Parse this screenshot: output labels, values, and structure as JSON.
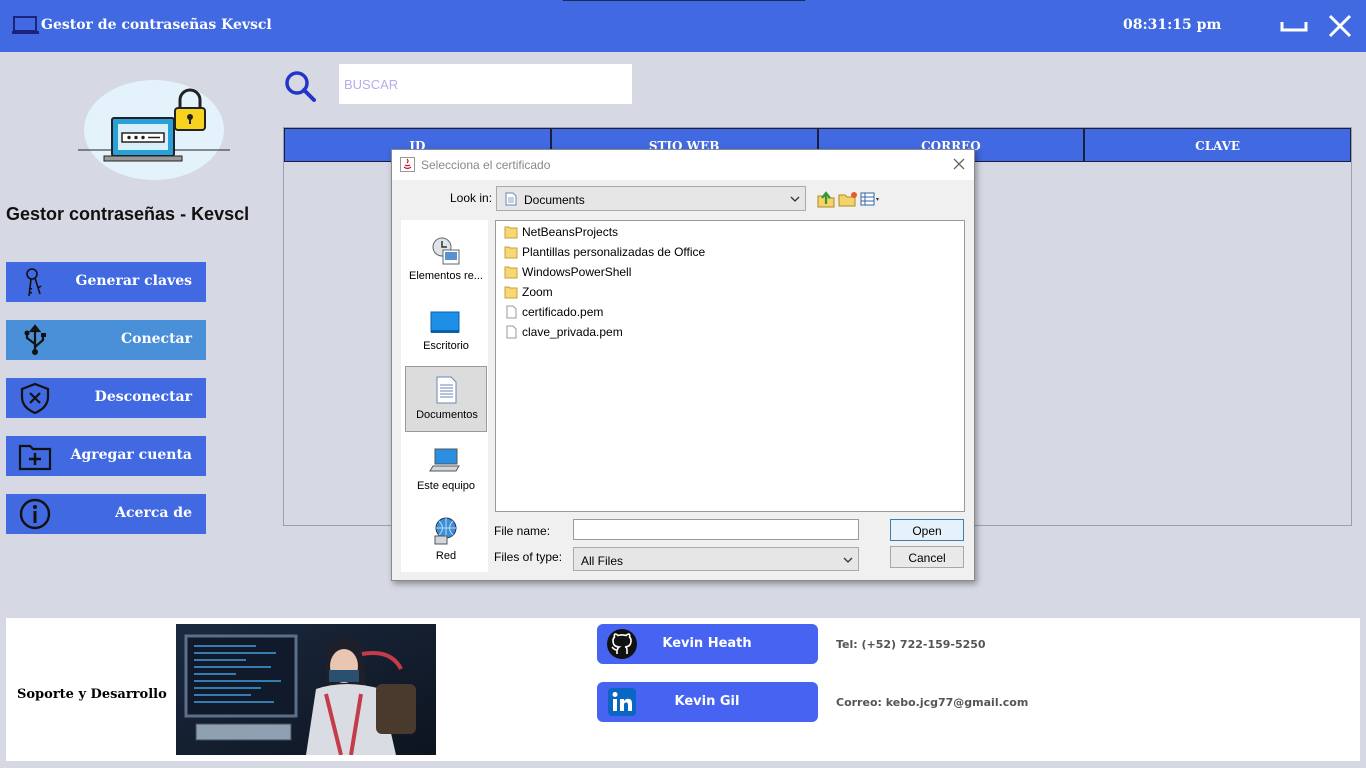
{
  "titlebar": {
    "title": "Gestor de contraseñas Kevscl",
    "time": "08:31:15 pm"
  },
  "sidebar": {
    "brand": "Gestor contraseñas - Kevscl",
    "buttons": [
      {
        "label": "Generar claves",
        "icon": "key-icon"
      },
      {
        "label": "Conectar",
        "icon": "usb-icon"
      },
      {
        "label": "Desconectar",
        "icon": "shield-x-icon"
      },
      {
        "label": "Agregar cuenta",
        "icon": "folder-plus-icon"
      },
      {
        "label": "Acerca de",
        "icon": "info-icon"
      }
    ]
  },
  "search": {
    "placeholder": "BUSCAR"
  },
  "table": {
    "columns": [
      "ID",
      "STIO WEB",
      "CORREO",
      "CLAVE"
    ]
  },
  "dialog": {
    "title": "Selecciona el certificado",
    "look_in_label": "Look in:",
    "look_in_value": "Documents",
    "places": [
      {
        "label": "Elementos re..."
      },
      {
        "label": "Escritorio"
      },
      {
        "label": "Documentos"
      },
      {
        "label": "Este equipo"
      },
      {
        "label": "Red"
      }
    ],
    "files": [
      {
        "name": "NetBeansProjects",
        "type": "folder"
      },
      {
        "name": "Plantillas personalizadas de Office",
        "type": "folder"
      },
      {
        "name": "WindowsPowerShell",
        "type": "folder"
      },
      {
        "name": "Zoom",
        "type": "folder"
      },
      {
        "name": "certificado.pem",
        "type": "file"
      },
      {
        "name": "clave_privada.pem",
        "type": "file"
      }
    ],
    "file_name_label": "File name:",
    "file_name_value": "",
    "files_of_type_label": "Files of type:",
    "files_of_type_value": "All Files",
    "open_label": "Open",
    "cancel_label": "Cancel"
  },
  "footer": {
    "support": "Soporte y Desarrollo",
    "github_name": "Kevin Heath",
    "linkedin_name": "Kevin Gil",
    "phone": "Tel: (+52) 722-159-5250",
    "email": "Correo: kebo.jcg77@gmail.com"
  },
  "colors": {
    "accent": "#4169e1",
    "background": "#d6d9e4",
    "social": "#4663f2"
  }
}
